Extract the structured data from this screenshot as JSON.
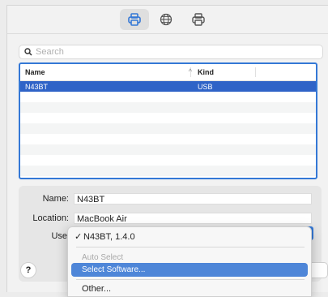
{
  "toolbar": {
    "buttons": [
      {
        "icon": "printer-icon",
        "selected": true
      },
      {
        "icon": "globe-icon",
        "selected": false
      },
      {
        "icon": "windows-printer-icon",
        "selected": false
      }
    ]
  },
  "search": {
    "placeholder": "Search",
    "value": ""
  },
  "table": {
    "columns": [
      "Name",
      "Kind"
    ],
    "sort_indicator": "^",
    "rows": [
      {
        "name": "N43BT",
        "kind": "USB",
        "selected": true
      }
    ]
  },
  "details": {
    "name_label": "Name:",
    "name_value": "N43BT",
    "location_label": "Location:",
    "location_value": "MacBook Air",
    "use_label": "Use"
  },
  "use_menu": {
    "items": [
      {
        "label": "N43BT, 1.4.0",
        "checked": true
      },
      {
        "label": "Auto Select",
        "disabled": true
      },
      {
        "label": "Select Software...",
        "highlighted": true
      },
      {
        "label": "Other..."
      }
    ],
    "check_glyph": "✓"
  },
  "footer": {
    "help_label": "?"
  },
  "colors": {
    "accent": "#3478d6",
    "selection": "#2f63c7",
    "highlight": "#4e86d8"
  }
}
